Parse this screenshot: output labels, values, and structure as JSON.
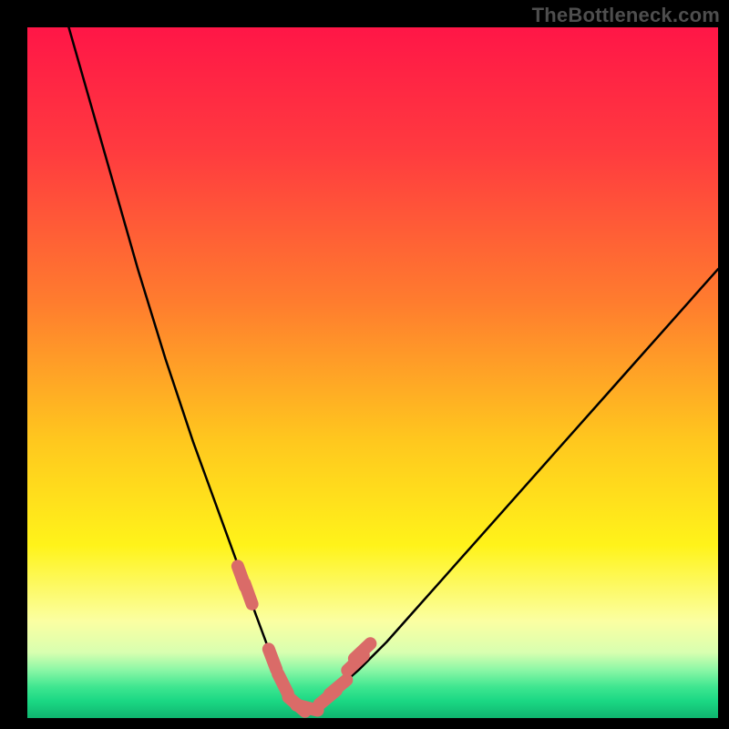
{
  "watermark": "TheBottleneck.com",
  "chart_data": {
    "type": "line",
    "title": "",
    "xlabel": "",
    "ylabel": "",
    "xlim": [
      0,
      100
    ],
    "ylim": [
      0,
      100
    ],
    "curve": {
      "name": "bottleneck-curve",
      "x": [
        6,
        8,
        10,
        12,
        14,
        16,
        18,
        20,
        22,
        24,
        26,
        28,
        30,
        32,
        33,
        34,
        35,
        36,
        37,
        38,
        39,
        40,
        41,
        42,
        44,
        48,
        52,
        56,
        60,
        64,
        68,
        72,
        76,
        80,
        84,
        88,
        92,
        96,
        100
      ],
      "y": [
        100,
        93,
        86,
        79,
        72,
        65,
        58.5,
        52,
        46,
        40,
        34.5,
        29,
        23.5,
        18,
        15.2,
        12.5,
        9.8,
        7.2,
        5.0,
        3.2,
        2.0,
        1.5,
        1.5,
        2.0,
        3.5,
        7.0,
        11.0,
        15.5,
        20.0,
        24.5,
        29.0,
        33.5,
        38.0,
        42.5,
        47.0,
        51.5,
        56.0,
        60.5,
        65.0
      ]
    },
    "markers": {
      "name": "highlighted-points",
      "color": "#da6b68",
      "points": [
        {
          "x": 31.0,
          "y": 20.5
        },
        {
          "x": 32.0,
          "y": 18.0
        },
        {
          "x": 35.5,
          "y": 8.5
        },
        {
          "x": 37.0,
          "y": 5.0
        },
        {
          "x": 39.0,
          "y": 2.0
        },
        {
          "x": 40.5,
          "y": 1.5
        },
        {
          "x": 43.5,
          "y": 3.0
        },
        {
          "x": 45.0,
          "y": 4.5
        },
        {
          "x": 47.5,
          "y": 8.0
        },
        {
          "x": 48.5,
          "y": 9.7
        }
      ]
    },
    "gradient_stops": [
      {
        "offset": 0.0,
        "color": "#ff1647"
      },
      {
        "offset": 0.18,
        "color": "#ff3b3f"
      },
      {
        "offset": 0.4,
        "color": "#ff7d2e"
      },
      {
        "offset": 0.6,
        "color": "#ffc81e"
      },
      {
        "offset": 0.75,
        "color": "#fff31a"
      },
      {
        "offset": 0.86,
        "color": "#fbffa2"
      },
      {
        "offset": 0.905,
        "color": "#d8ffb0"
      },
      {
        "offset": 0.93,
        "color": "#8cf7a6"
      },
      {
        "offset": 0.955,
        "color": "#3fe690"
      },
      {
        "offset": 0.975,
        "color": "#1bd884"
      },
      {
        "offset": 1.0,
        "color": "#0fb56f"
      }
    ]
  }
}
